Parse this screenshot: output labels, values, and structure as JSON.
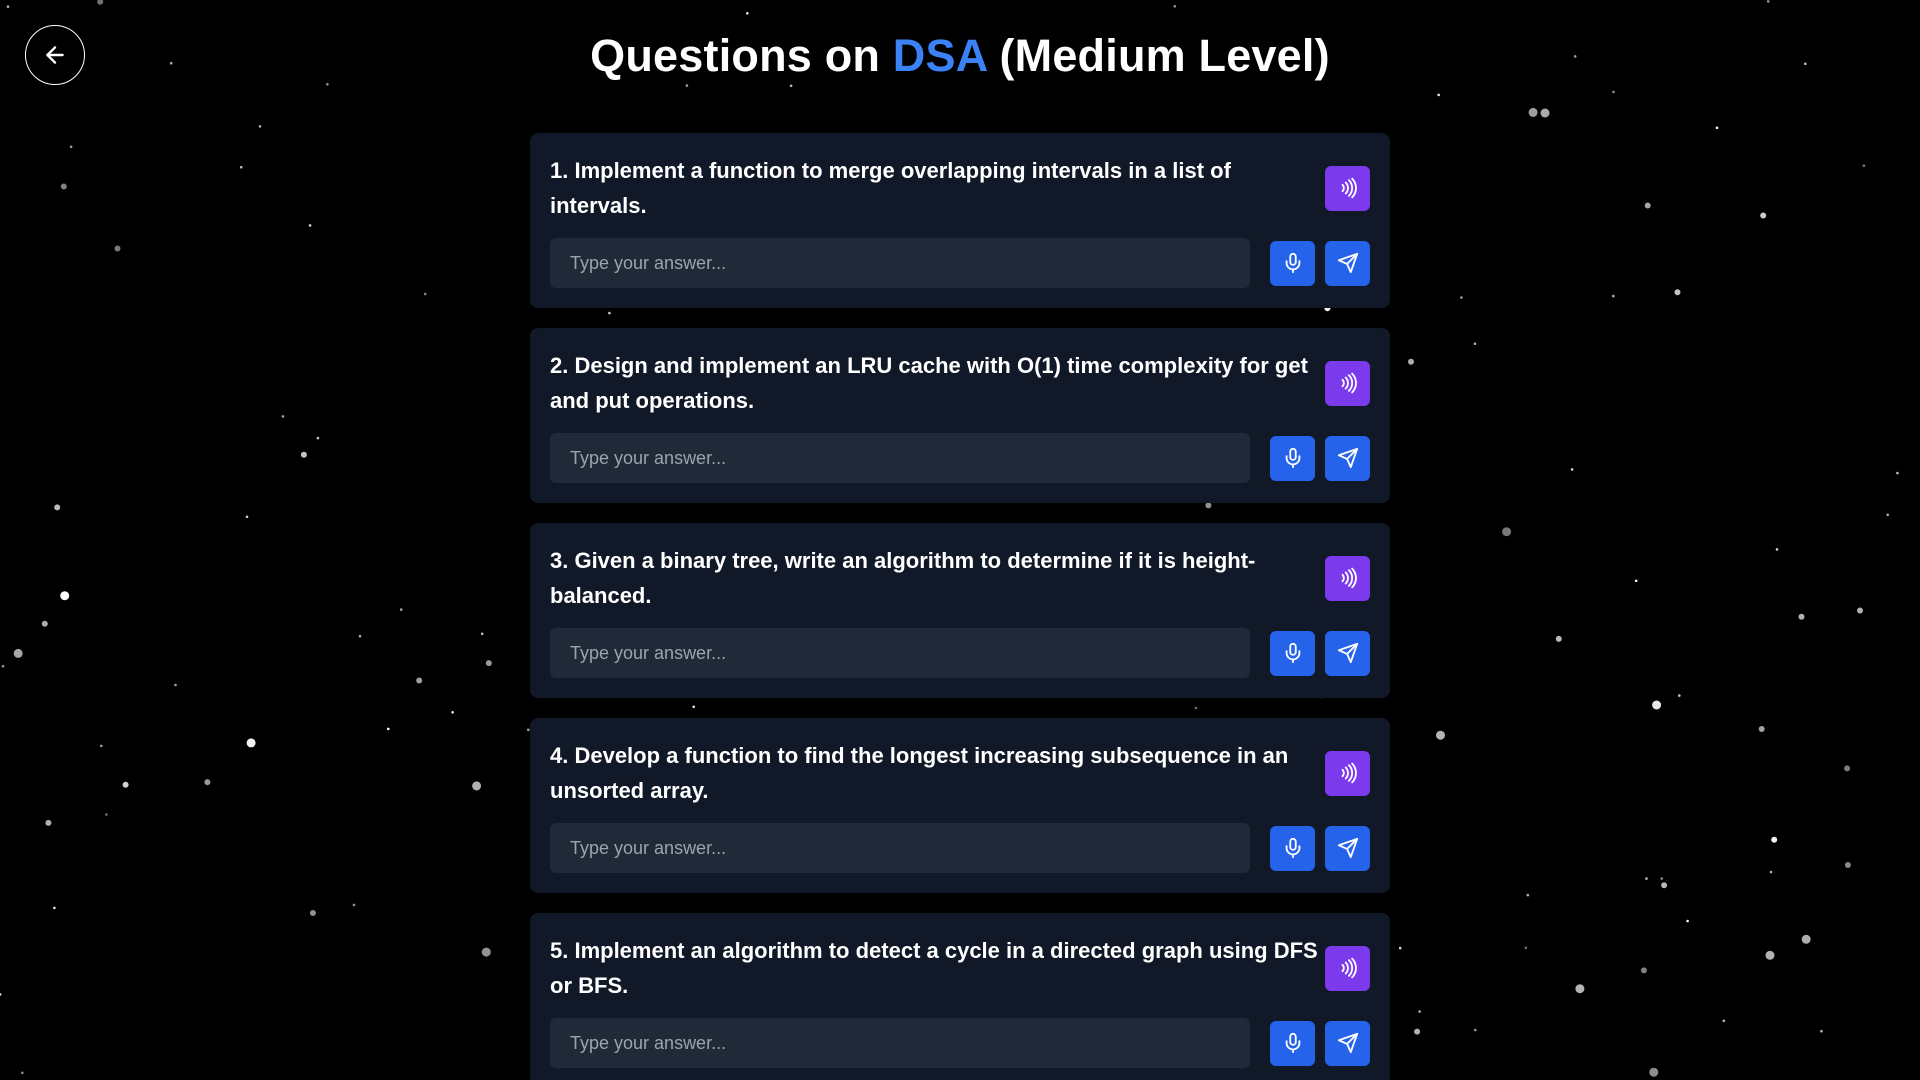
{
  "header": {
    "title_prefix": "Questions on ",
    "title_accent": "DSA",
    "title_suffix": " (Medium Level)"
  },
  "input_placeholder": "Type your answer...",
  "questions": [
    {
      "text": "1. Implement a function to merge overlapping intervals in a list of intervals."
    },
    {
      "text": "2. Design and implement an LRU cache with O(1) time complexity for get and put operations."
    },
    {
      "text": "3. Given a binary tree, write an algorithm to determine if it is height-balanced."
    },
    {
      "text": "4. Develop a function to find the longest increasing subsequence in an unsorted array."
    },
    {
      "text": "5. Implement an algorithm to detect a cycle in a directed graph using DFS or BFS."
    }
  ],
  "icons": {
    "back": "arrow-left-icon",
    "speak": "speaker-waves-icon",
    "mic": "microphone-icon",
    "send": "send-icon"
  },
  "colors": {
    "background": "#000000",
    "card": "#111827",
    "input": "#1f2937",
    "accent": "#3b82f6",
    "speak_button": "#7c3aed",
    "action_button": "#2563eb"
  }
}
